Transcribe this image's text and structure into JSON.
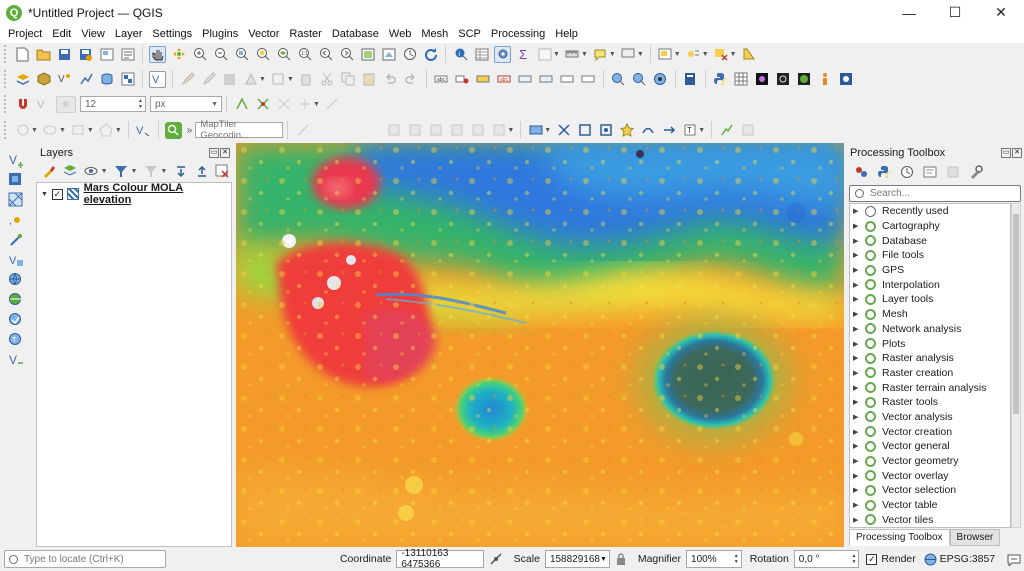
{
  "window": {
    "title": "*Untitled Project — QGIS",
    "logo": "Q",
    "minimize": "—",
    "maximize": "☐",
    "close": "✕"
  },
  "menu": [
    "Project",
    "Edit",
    "View",
    "Layer",
    "Settings",
    "Plugins",
    "Vector",
    "Raster",
    "Database",
    "Web",
    "Mesh",
    "SCP",
    "Processing",
    "Help"
  ],
  "digitize": {
    "size_value": "12",
    "unit_value": "px"
  },
  "locator_toolbar": {
    "geocoder_placeholder": "MapTiler Geocodin..."
  },
  "layers_panel": {
    "title": "Layers",
    "layer": {
      "name": "Mars Colour MOLA elevation",
      "checked": "✓"
    }
  },
  "processing_panel": {
    "title": "Processing Toolbox",
    "search_placeholder": "Search...",
    "items": [
      "Recently used",
      "Cartography",
      "Database",
      "File tools",
      "GPS",
      "Interpolation",
      "Layer tools",
      "Mesh",
      "Network analysis",
      "Plots",
      "Raster analysis",
      "Raster creation",
      "Raster terrain analysis",
      "Raster tools",
      "Vector analysis",
      "Vector creation",
      "Vector general",
      "Vector geometry",
      "Vector overlay",
      "Vector selection",
      "Vector table",
      "Vector tiles"
    ],
    "tabs": [
      "Processing Toolbox",
      "Browser"
    ]
  },
  "statusbar": {
    "locate_placeholder": "Type to locate (Ctrl+K)",
    "coordinate_label": "Coordinate",
    "coordinate_value": "-13110163 6475366",
    "scale_label": "Scale",
    "scale_value": "158829168",
    "magnifier_label": "Magnifier",
    "magnifier_value": "100%",
    "rotation_label": "Rotation",
    "rotation_value": "0,0 °",
    "render_label": "Render",
    "render_checked": "✓",
    "crs": "EPSG:3857"
  },
  "colors": {
    "accent_green": "#5fae3c",
    "map_ocean_blue": "#2a6fd6",
    "map_highland_red": "#f0433a"
  }
}
